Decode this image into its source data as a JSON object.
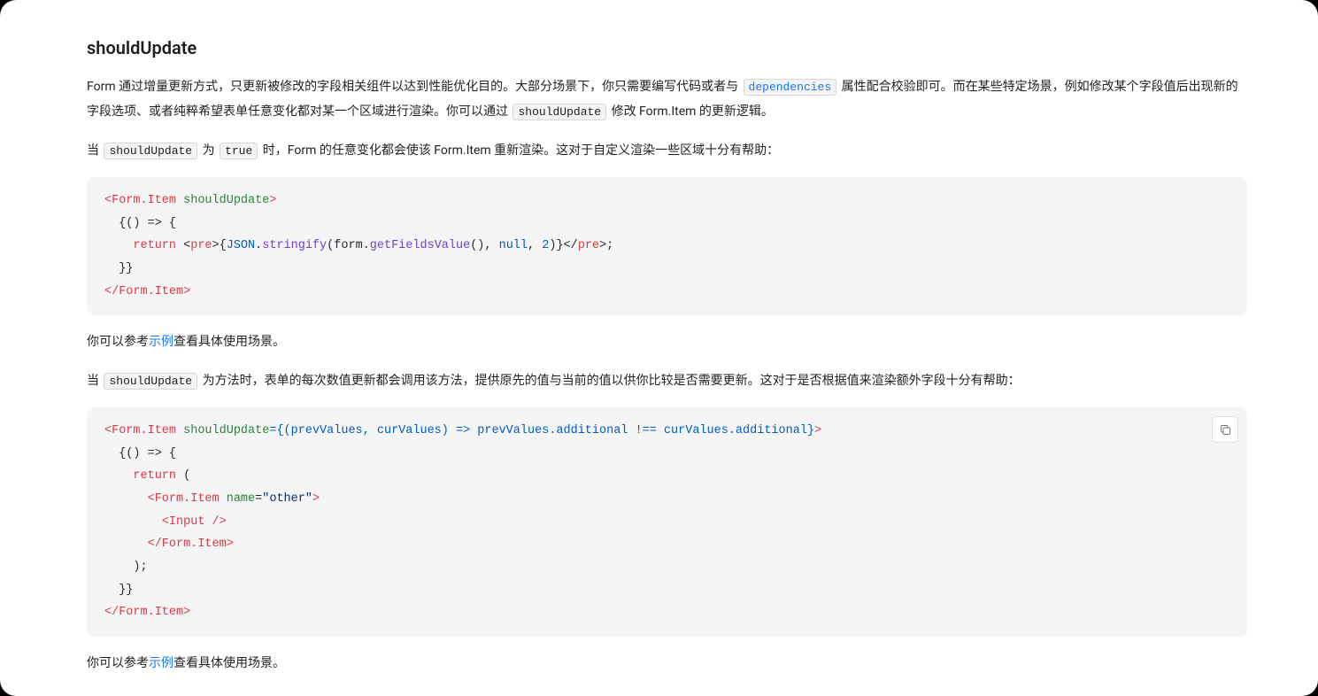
{
  "heading": "shouldUpdate",
  "p1": {
    "t1": "Form 通过增量更新方式，只更新被修改的字段相关组件以达到性能优化目的。大部分场景下，你只需要编写代码或者与 ",
    "code1": "dependencies",
    "t2": " 属性配合校验即可。而在某些特定场景，例如修改某个字段值后出现新的字段选项、或者纯粹希望表单任意变化都对某一个区域进行渲染。你可以通过 ",
    "code2": "shouldUpdate",
    "t3": " 修改 Form.Item 的更新逻辑。"
  },
  "p2": {
    "t1": "当 ",
    "code1": "shouldUpdate",
    "t2": " 为 ",
    "code2": "true",
    "t3": " 时，Form 的任意变化都会使该 Form.Item 重新渲染。这对于自定义渲染一些区域十分有帮助："
  },
  "code1": {
    "line1": {
      "a": "<Form.Item",
      "b": " shouldUpdate",
      "c": ">"
    },
    "line2": "  {() => {",
    "line3": {
      "a": "    ",
      "b": "return",
      "c": " <",
      "d": "pre",
      "e": ">{",
      "f": "JSON",
      "g": ".",
      "h": "stringify",
      "i": "(form.",
      "j": "getFieldsValue",
      "k": "(), ",
      "l": "null",
      "m": ", ",
      "n": "2",
      "o": ")}</",
      "p": "pre",
      "q": ">;"
    },
    "line4": "  }}",
    "line5": "</Form.Item>"
  },
  "p3": {
    "t1": "你可以参考",
    "link": "示例",
    "t2": "查看具体使用场景。"
  },
  "p4": {
    "t1": "当 ",
    "code1": "shouldUpdate",
    "t2": " 为方法时，表单的每次数值更新都会调用该方法，提供原先的值与当前的值以供你比较是否需要更新。这对于是否根据值来渲染额外字段十分有帮助："
  },
  "code2": {
    "line1": {
      "a": "<Form.Item",
      "b": " shouldUpdate",
      "c": "={(prevValues, curValues) => prevValues.additional !== curValues.additional}",
      "d": ">"
    },
    "line2": "  {() => {",
    "line3": {
      "a": "    ",
      "b": "return",
      "c": " ("
    },
    "line4": {
      "a": "      <Form.Item",
      "b": " name",
      "c": "=",
      "d": "\"other\"",
      "e": ">"
    },
    "line5": {
      "a": "        <Input",
      "b": " />"
    },
    "line6": "      </Form.Item>",
    "line7": "    );",
    "line8": "  }}",
    "line9": "</Form.Item>"
  },
  "p5": {
    "t1": "你可以参考",
    "link": "示例",
    "t2": "查看具体使用场景。"
  },
  "copy_label": "Copy"
}
